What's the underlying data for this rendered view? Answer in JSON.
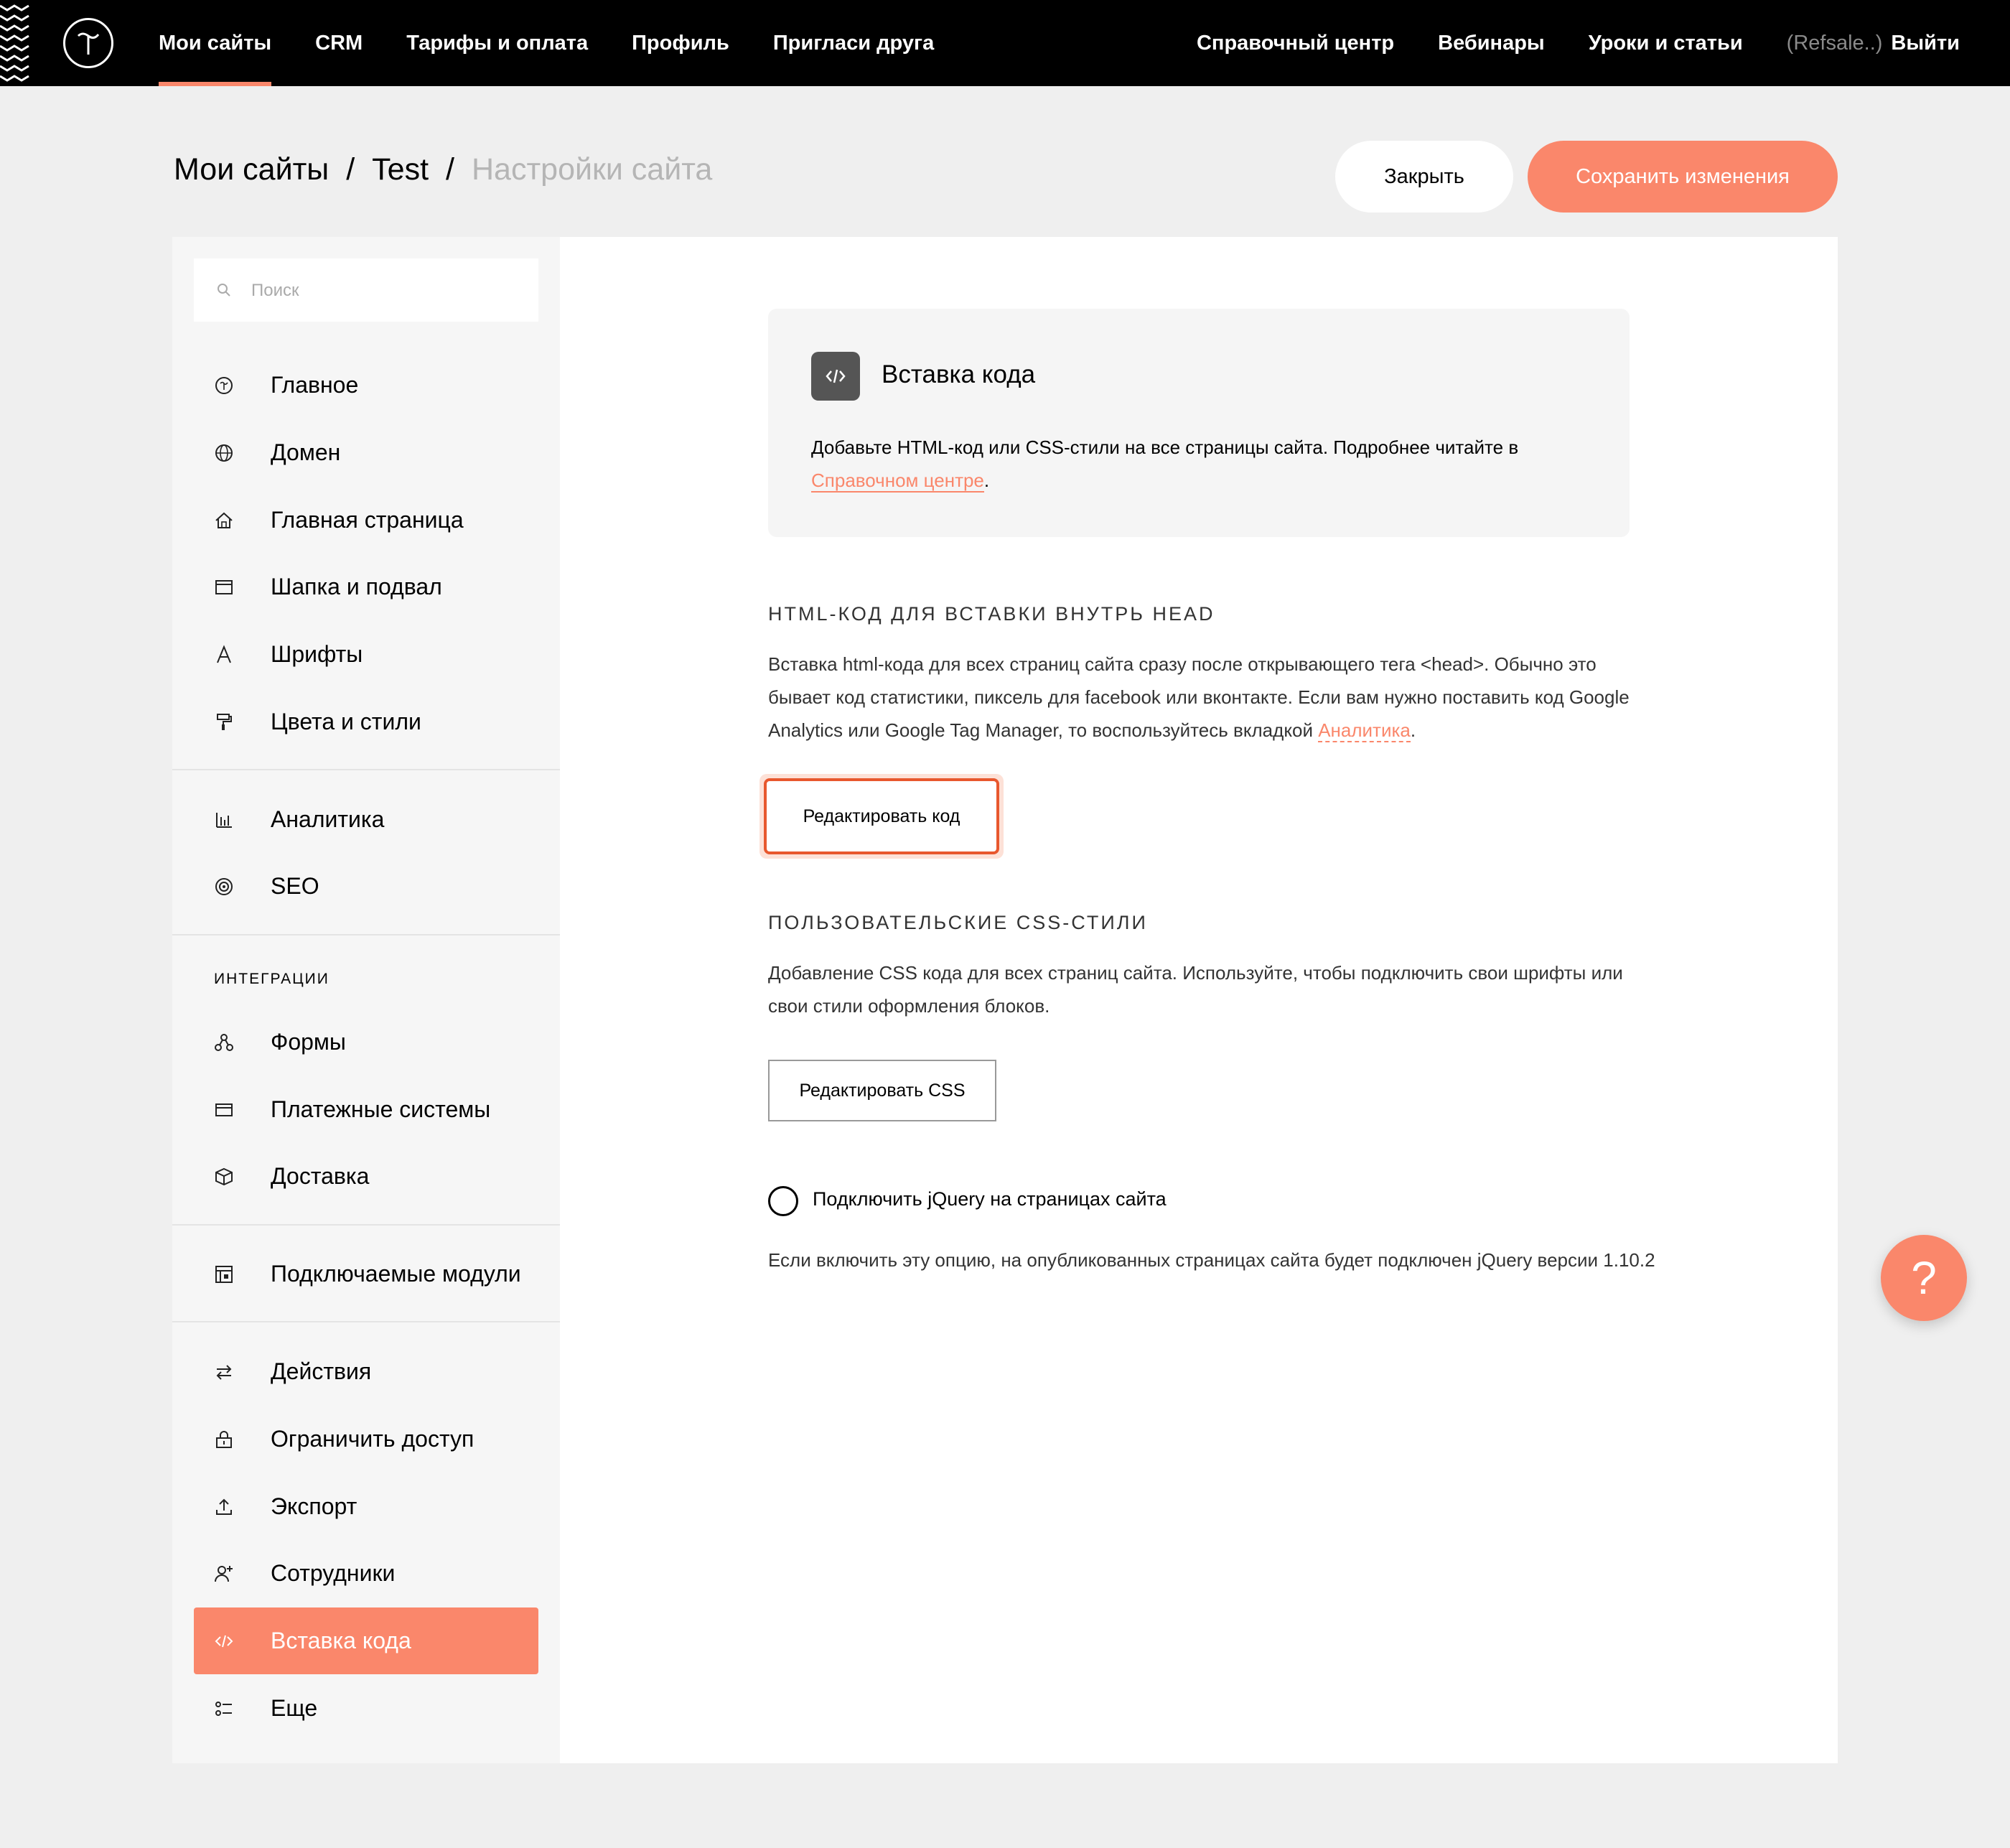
{
  "nav": {
    "left": [
      "Мои сайты",
      "CRM",
      "Тарифы и оплата",
      "Профиль",
      "Пригласи друга"
    ],
    "right": [
      "Справочный центр",
      "Вебинары",
      "Уроки и статьи"
    ],
    "user": "(Refsale..)",
    "logout": "Выйти"
  },
  "breadcrumb": {
    "sites": "Мои сайты",
    "project": "Test",
    "current": "Настройки сайта"
  },
  "actions": {
    "close": "Закрыть",
    "save": "Сохранить изменения"
  },
  "sidebar": {
    "search_placeholder": "Поиск",
    "items": [
      {
        "label": "Главное",
        "icon": "tilda-logo-icon"
      },
      {
        "label": "Домен",
        "icon": "globe-icon"
      },
      {
        "label": "Главная страница",
        "icon": "home-icon"
      },
      {
        "label": "Шапка и подвал",
        "icon": "header-footer-icon"
      },
      {
        "label": "Шрифты",
        "icon": "font-icon"
      },
      {
        "label": "Цвета и стили",
        "icon": "paint-roller-icon"
      },
      {
        "label": "Аналитика",
        "icon": "bar-chart-icon"
      },
      {
        "label": "SEO",
        "icon": "target-icon"
      },
      {
        "label": "Формы",
        "icon": "forms-icon"
      },
      {
        "label": "Платежные системы",
        "icon": "credit-card-icon"
      },
      {
        "label": "Доставка",
        "icon": "package-icon"
      },
      {
        "label": "Подключаемые модули",
        "icon": "module-icon"
      },
      {
        "label": "Действия",
        "icon": "arrows-icon"
      },
      {
        "label": "Ограничить доступ",
        "icon": "lock-icon"
      },
      {
        "label": "Экспорт",
        "icon": "upload-icon"
      },
      {
        "label": "Сотрудники",
        "icon": "add-user-icon"
      },
      {
        "label": "Вставка кода",
        "icon": "code-icon"
      },
      {
        "label": "Еще",
        "icon": "more-icon"
      }
    ],
    "section_integrations": "ИНТЕГРАЦИИ"
  },
  "card": {
    "title": "Вставка кода",
    "desc": "Добавьте HTML-код или CSS-стили на все страницы сайта. Подробнее читайте в",
    "link": "Справочном центре",
    "period": "."
  },
  "head_section": {
    "title": "HTML-КОД ДЛЯ ВСТАВКИ ВНУТРЬ HEAD",
    "text": "Вставка html-кода для всех страниц сайта сразу после открывающего тега <head>. Обычно это бывает код статистики, пиксель для facebook или вконтакте. Если вам нужно поставить код Google Analytics или Google Tag Manager, то воспользуйтесь вкладкой",
    "link": "Аналитика",
    "period": ".",
    "button": "Редактировать код"
  },
  "css_section": {
    "title": "ПОЛЬЗОВАТЕЛЬСКИЕ CSS-СТИЛИ",
    "text": "Добавление CSS кода для всех страниц сайта. Используйте, чтобы подключить свои шрифты или свои стили оформления блоков.",
    "button": "Редактировать CSS"
  },
  "jquery": {
    "label": "Подключить jQuery на страницах сайта",
    "note": "Если включить эту опцию, на опубликованных страницах сайта будет подключен jQuery версии 1.10.2"
  },
  "help": {
    "label": "?"
  },
  "colors": {
    "accent": "#fa876b",
    "focus": "#e8582e",
    "topbar": "#000000"
  }
}
